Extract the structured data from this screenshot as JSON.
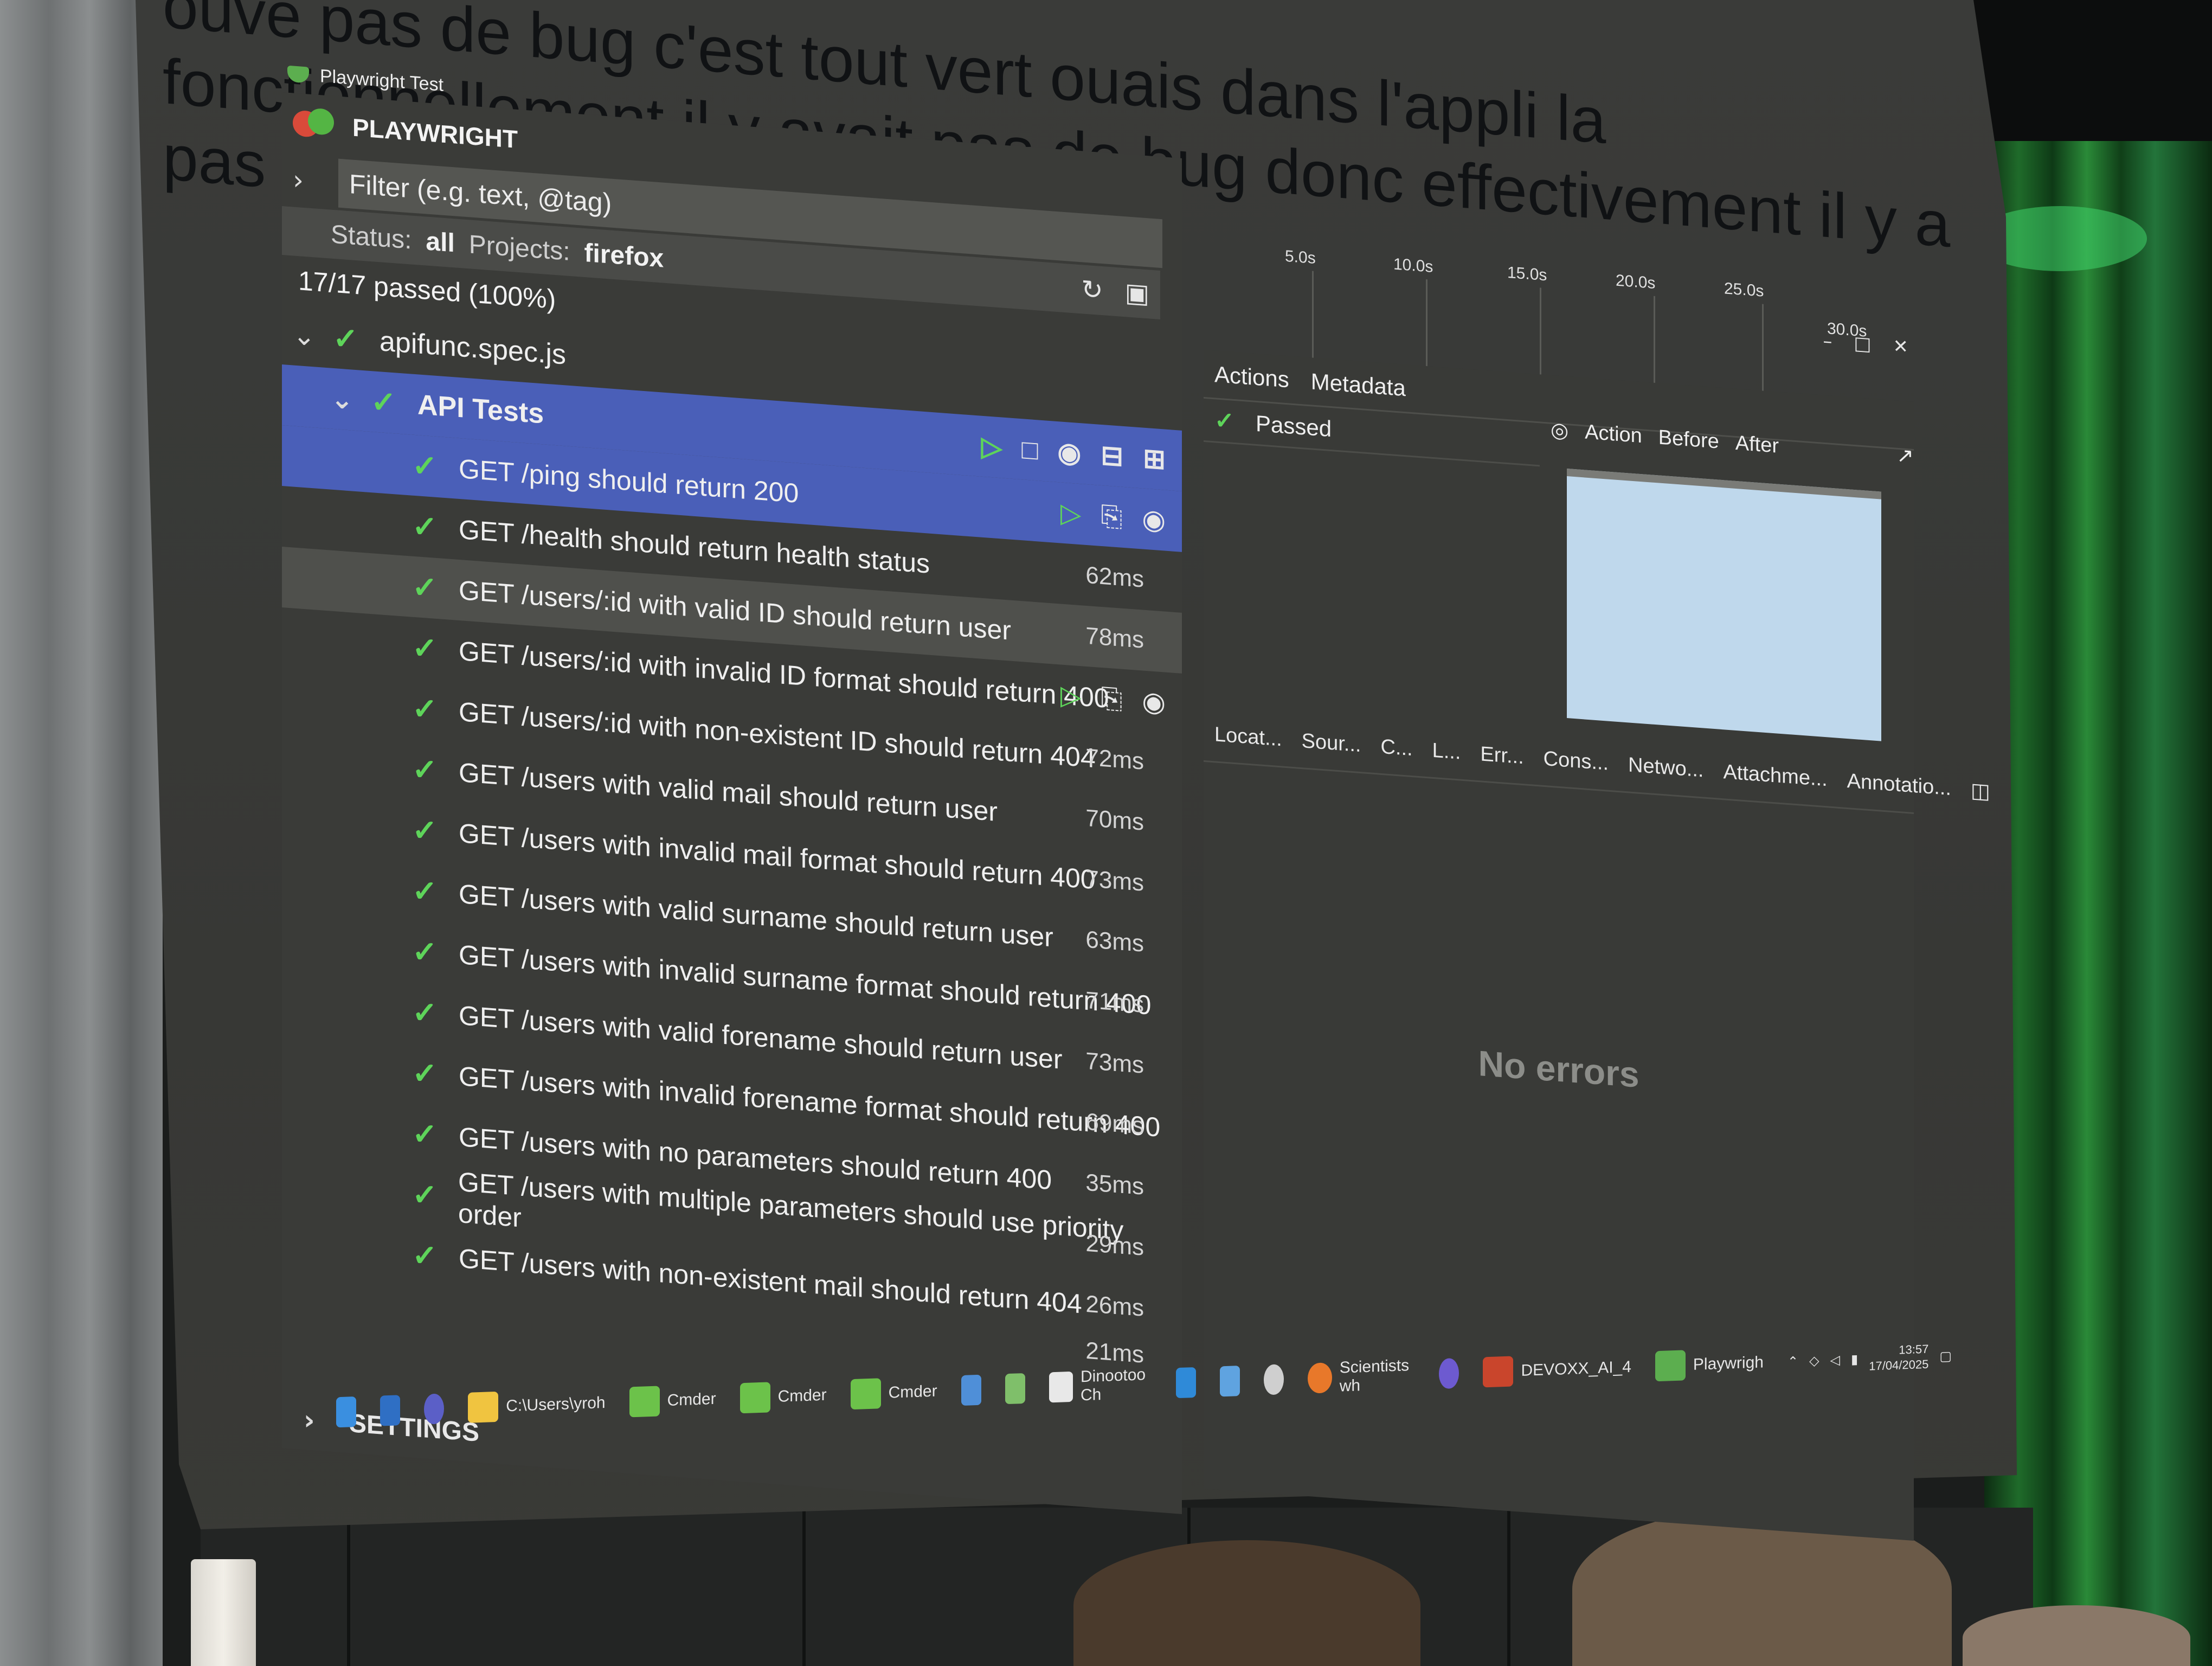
{
  "caption": {
    "line1": "ouve pas de bug c'est tout vert ouais dans l'appli la",
    "line2": "fonctionnellement il y avait pas de bug donc effectivement il y a pas eu donc"
  },
  "window": {
    "title": "Playwright Test"
  },
  "sidebar": {
    "brand": "PLAYWRIGHT",
    "filter_placeholder": "Filter (e.g. text, @tag)",
    "status_label": "Status:",
    "status_value": "all",
    "projects_label": "Projects:",
    "projects_value": "firefox",
    "summary": "17/17 passed (100%)",
    "file": "apifunc.spec.js",
    "suite": "API Tests",
    "tests": [
      {
        "name": "GET /ping should return 200",
        "duration": ""
      },
      {
        "name": "GET /health should return health status",
        "duration": "62ms"
      },
      {
        "name": "GET /users/:id with valid ID should return user",
        "duration": "78ms"
      },
      {
        "name": "GET /users/:id with invalid ID format should return 400",
        "duration": ""
      },
      {
        "name": "GET /users/:id with non-existent ID should return 404",
        "duration": "72ms"
      },
      {
        "name": "GET /users with valid mail should return user",
        "duration": "70ms"
      },
      {
        "name": "GET /users with invalid mail format should return 400",
        "duration": "73ms"
      },
      {
        "name": "GET /users with valid surname should return user",
        "duration": "63ms"
      },
      {
        "name": "GET /users with invalid surname format should return 400",
        "duration": "71ms"
      },
      {
        "name": "GET /users with valid forename should return user",
        "duration": "73ms"
      },
      {
        "name": "GET /users with invalid forename format should return 400",
        "duration": "69ms"
      },
      {
        "name": "GET /users with no parameters should return 400",
        "duration": "35ms"
      },
      {
        "name": "GET /users with multiple parameters should use priority order",
        "duration": "29ms"
      },
      {
        "name": "GET /users with non-existent mail should return 404",
        "duration": "26ms"
      }
    ],
    "last_duration": "21ms",
    "settings": "SETTINGS"
  },
  "viewer": {
    "timeline_ticks": [
      "5.0s",
      "10.0s",
      "15.0s",
      "20.0s",
      "25.0s",
      "30.0s"
    ],
    "tabs": [
      "Actions",
      "Metadata"
    ],
    "action_item": "Passed",
    "snapshot_tabs": [
      "Action",
      "Before",
      "After"
    ],
    "bottom_tabs": [
      "Locat...",
      "Sour...",
      "C...",
      "L...",
      "Err...",
      "Cons...",
      "Netwo...",
      "Attachme...",
      "Annotatio..."
    ],
    "empty_state": "No errors"
  },
  "taskbar": {
    "items": [
      "C:\\Users\\yroh",
      "Cmder",
      "Cmder",
      "Cmder",
      "Dinootoo Ch",
      "Scientists wh",
      "DEVOXX_AI_4",
      "Playwrigh"
    ],
    "time": "13:57",
    "date": "17/04/2025"
  },
  "colors": {
    "pass_green": "#5ed45a",
    "selection_blue": "#4a5fb8",
    "panel_bg": "#3a3b38"
  }
}
